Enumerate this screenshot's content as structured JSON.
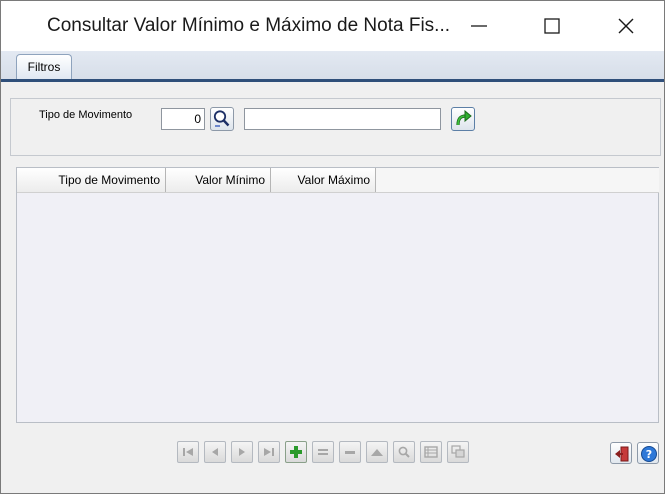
{
  "window": {
    "title": "Consultar Valor Mínimo e Máximo de Nota Fis...",
    "buttons": [
      "minimize-icon",
      "maximize-icon",
      "close-icon"
    ]
  },
  "tabs": [
    {
      "label": "Filtros",
      "active": true
    }
  ],
  "filters": {
    "tipo_movimento_label": "Tipo de Movimento",
    "tipo_movimento_code": "0",
    "tipo_movimento_desc": "",
    "search_icon": "magnifier-icon",
    "apply_icon": "green-arrow-refresh-icon"
  },
  "grid": {
    "columns": [
      "Tipo de Movimento",
      "Valor Mínimo",
      "Valor Máximo"
    ],
    "rows": []
  },
  "navigator": {
    "buttons": [
      "first-icon",
      "prior-icon",
      "next-icon",
      "last-icon",
      "insert-icon",
      "edit-icon",
      "delete-icon",
      "post-icon",
      "search-icon",
      "form-icon",
      "refresh-icon"
    ],
    "enabled": {
      "insert-icon": true
    },
    "accent_color": "#2a9a2a"
  },
  "actions": {
    "exit_icon": "exit-door-icon",
    "help_icon": "help-icon"
  }
}
